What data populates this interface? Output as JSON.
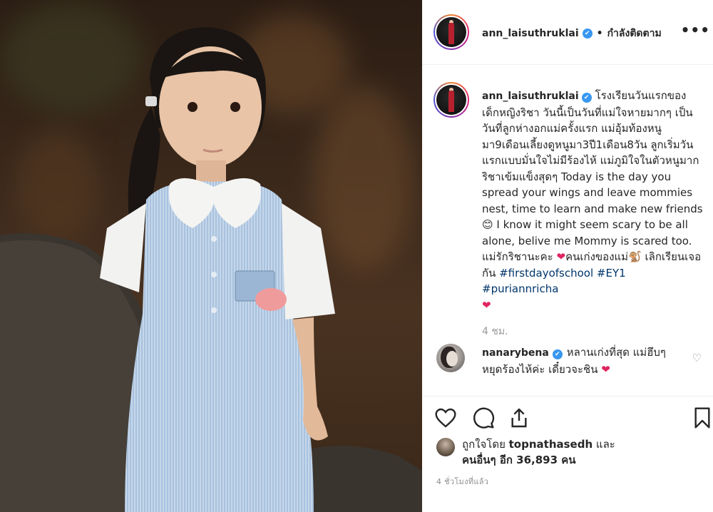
{
  "post": {
    "username": "ann_laisuthruklai",
    "verified_mark": "✔",
    "separator": "•",
    "follow_status": "กำลังติดตาม",
    "more_icon": "•••",
    "caption_parts": [
      "โรงเรียนวันแรกของเด็กหญิงริชา วันนี้เป็นวันที่แม่ใจหายมากๆ เป็นวันที่ลูกห่างอกแม่ครั้งแรก แม่อุ้มท้องหนูมา9เดือนเลี้ยงดูหนูมา3ปี1เดือน8วัน ลูกเริ่มวันแรกแบบมั่นใจไม่มีร้องไห้ แม่ภูมิใจในตัวหนูมาก ริชาเข้มแข็งสุดๆ Today is the day you spread your wings and leave mommies nest, time to learn and make new friends",
      "😊",
      " I know it might seem scary to be all alone, belive me Mommy is scared too. แม่รักริชานะคะ ",
      "❤",
      "คนเก่งของแม่",
      "🐒",
      " เลิกเรียนเจอกัน "
    ],
    "hashtags": "#firstdayofschool #EY1 #puriannricha",
    "end_heart": "❤",
    "caption_time": "4 ชม.",
    "comment": {
      "username": "nanarybena",
      "verified_mark": "✔",
      "text": "หลานเก่งที่สุด แม่ฮึบๆ หยุดร้องไห้ค่ะ เดี๋ยวจะชิน ",
      "heart": "❤",
      "like_icon": "♡"
    },
    "likes": {
      "prefix": "ถูกใจโดย ",
      "liker": "topnathasedh",
      "middle": " และ",
      "others_prefix": "คนอื่นๆ อีก ",
      "others_count": "36,893 คน"
    },
    "post_time": "4 ชั่วโมงที่แล้ว"
  },
  "colors": {
    "verified_blue": "#3897f0",
    "hashtag": "#003569",
    "heart_red": "#e0245e",
    "muted_text": "#999999"
  },
  "icons": {
    "like": "heart-outline-icon",
    "comment": "comment-bubble-icon",
    "share": "share-upload-icon",
    "save": "bookmark-icon"
  }
}
